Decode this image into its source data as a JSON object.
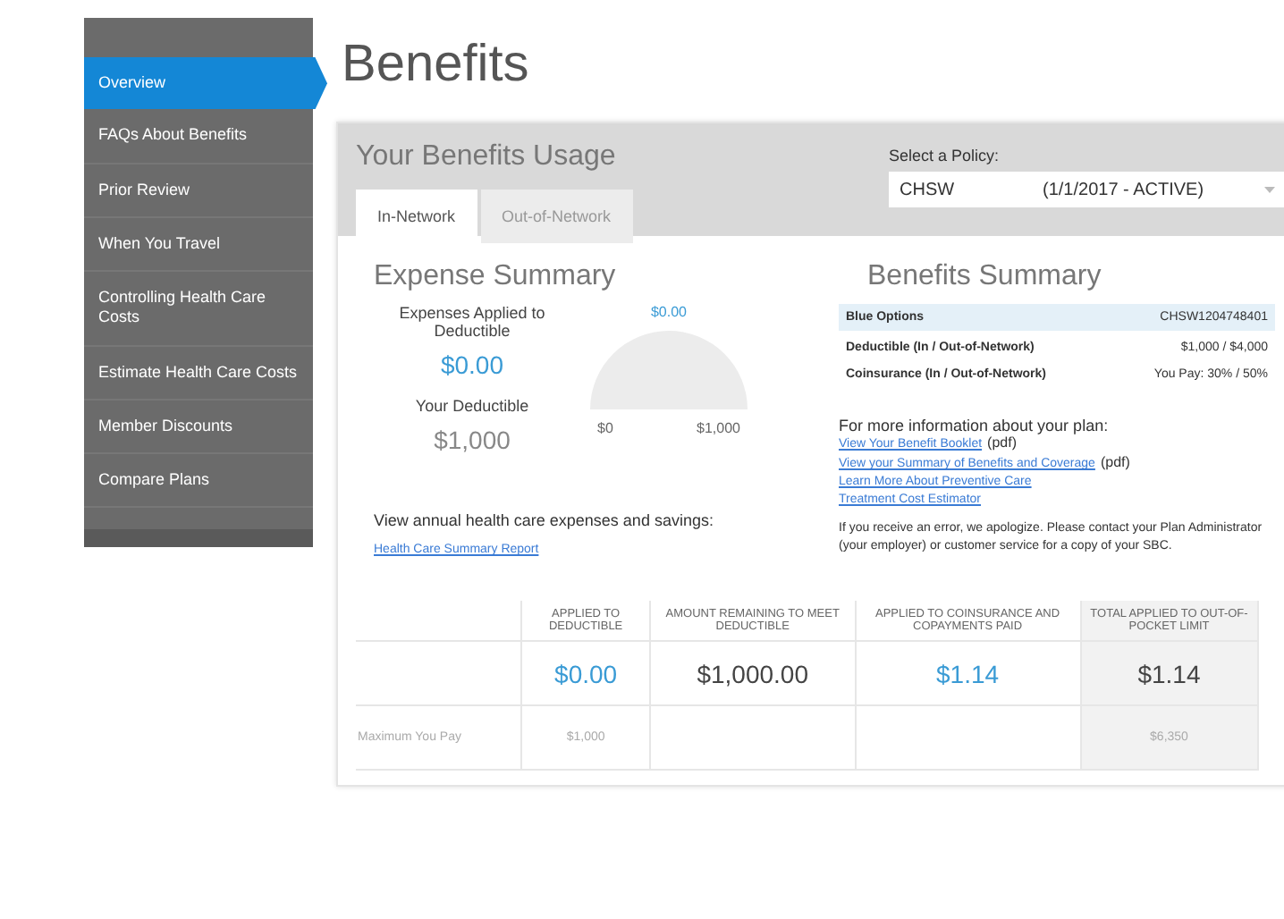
{
  "sidebar": {
    "items": [
      {
        "label": "Overview",
        "selected": true
      },
      {
        "label": "FAQs About Benefits",
        "selected": false
      },
      {
        "label": "Prior Review",
        "selected": false
      },
      {
        "label": "When You Travel",
        "selected": false
      },
      {
        "label": "Controlling Health Care Costs",
        "selected": false
      },
      {
        "label": "Estimate Health Care Costs",
        "selected": false
      },
      {
        "label": "Member Discounts",
        "selected": false
      },
      {
        "label": "Compare Plans",
        "selected": false
      }
    ]
  },
  "page_title": "Benefits",
  "usage": {
    "title": "Your Benefits Usage",
    "tabs": [
      {
        "label": "In-Network",
        "selected": true
      },
      {
        "label": "Out-of-Network",
        "selected": false
      }
    ],
    "policy": {
      "label": "Select a Policy:",
      "value": "CHSW",
      "period": "(1/1/2017 - ACTIVE)"
    }
  },
  "expense_summary": {
    "title": "Expense Summary",
    "applied_label": "Expenses Applied to Deductible",
    "applied_value": "$0.00",
    "deductible_label": "Your Deductible",
    "deductible_value": "$1,000",
    "gauge": {
      "reading": "$0.00",
      "min_label": "$0",
      "max_label": "$1,000"
    },
    "report_text": "View annual health care expenses and savings:",
    "report_link": "Health Care Summary Report"
  },
  "benefits_summary": {
    "title": "Benefits Summary",
    "plan": "Blue Options",
    "plan_id": "CHSW1204748401",
    "rows": [
      {
        "label": "Deductible (In / Out-of-Network)",
        "value": "$1,000 / $4,000"
      },
      {
        "label": "Coinsurance (In / Out-of-Network)",
        "value": "You Pay: 30% / 50%"
      }
    ],
    "info_text": "For more information about your plan:",
    "links": [
      {
        "text": "View Your Benefit Booklet",
        "suffix": "(pdf)"
      },
      {
        "text": "View your Summary of Benefits and Coverage",
        "suffix": "(pdf)"
      },
      {
        "text": "Learn More About Preventive Care"
      },
      {
        "text": "Treatment Cost Estimator"
      }
    ],
    "note": "If you receive an error, we apologize. Please contact your Plan Administrator (your employer) or customer service for a copy of your SBC."
  },
  "table": {
    "columns": [
      "APPLIED TO DEDUCTIBLE",
      "AMOUNT REMAINING TO MEET DEDUCTIBLE",
      "APPLIED TO COINSURANCE AND COPAYMENTS PAID",
      "TOTAL APPLIED TO OUT-OF-POCKET LIMIT"
    ],
    "rows": [
      {
        "kind": "amounts",
        "cells": [
          {
            "text": "$0.00",
            "color": "#3a9bd5"
          },
          {
            "text": "$1,000.00",
            "color": "#444444"
          },
          {
            "text": "$1.14",
            "color": "#3a9bd5"
          },
          {
            "text": "$1.14",
            "color": "#444444"
          }
        ]
      },
      {
        "kind": "limits",
        "label": "Maximum You Pay",
        "cells": [
          {
            "text": "$1,000",
            "color": "#aaaaaa"
          },
          {},
          {},
          {
            "text": "$6,350",
            "color": "#aaaaaa"
          }
        ]
      }
    ]
  }
}
